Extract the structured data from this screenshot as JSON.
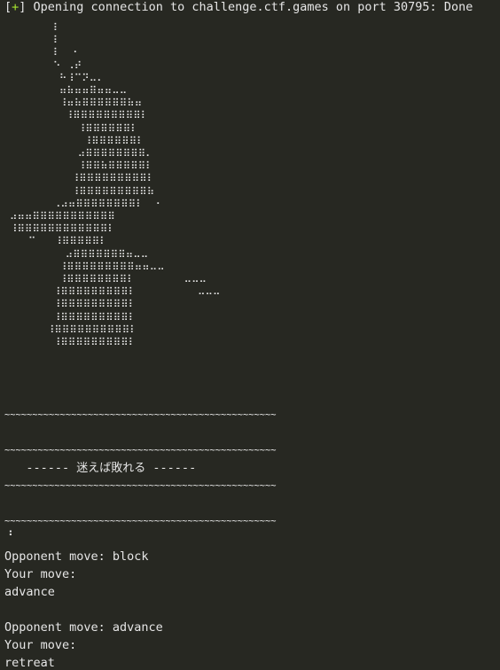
{
  "terminal": {
    "connection_prefix": "[",
    "connection_plus": "+",
    "connection_suffix": "] Opening connection to challenge.ctf.games on port 30795: Done",
    "ascii_art": "        ⠇\n        ⠇\n        ⠇  ⠂\n        ⠑ ⠠⠞\n         ⠓⠸⠉⠝⠤⠄\n         ⠶⠷⠶⠶⠿⠶⠶⠤⠤\n         ⠸⠶⠷⠿⠿⠿⠿⠿⠿⠷⠶\n          ⠸⠿⠿⠿⠿⠿⠿⠿⠿⠿⠇\n            ⠸⠿⠿⠿⠿⠿⠿⠇\n             ⠸⠿⠿⠿⠿⠿⠿⠇\n            ⠴⠿⠿⠿⠿⠿⠿⠿⠿⠄\n            ⠸⠿⠿⠷⠿⠿⠿⠿⠿⠇\n           ⠸⠿⠿⠿⠿⠿⠿⠿⠿⠿⠇\n           ⠸⠿⠿⠿⠿⠿⠿⠿⠿⠿⠷\n        ⠠⠴⠶⠿⠿⠿⠿⠿⠿⠿⠿⠇  ⠂\n ⠴⠶⠶⠿⠿⠿⠿⠿⠿⠿⠿⠿⠿⠿\n ⠸⠿⠿⠿⠿⠿⠿⠿⠿⠿⠿⠿⠿⠇\n    ⠉   ⠸⠿⠿⠿⠿⠿⠇\n          ⠴⠿⠿⠿⠿⠿⠿⠿⠶⠤⠤\n         ⠸⠿⠿⠿⠿⠿⠿⠿⠿⠿⠶⠶⠤⠤\n         ⠸⠿⠿⠿⠿⠿⠿⠿⠿⠇        ⠤⠤⠤\n        ⠸⠿⠿⠿⠿⠿⠿⠿⠿⠿⠇          ⠤⠤⠤\n        ⠸⠿⠿⠿⠿⠿⠿⠿⠿⠿⠇\n        ⠸⠿⠿⠿⠿⠿⠿⠿⠿⠿⠇\n       ⠸⠿⠿⠿⠿⠿⠿⠿⠿⠿⠿⠇\n        ⠸⠿⠿⠿⠿⠿⠿⠿⠿⠿⠇",
    "tilde_rule": "~~~~~~~~~~~~~~~~~~~~~~~~~~~~~~~~~~~~~~~~~~~~~~~~~",
    "banner_dashes_left": "   ------ ",
    "banner_japanese": "迷えば敗れる",
    "banner_dashes_right": " ------",
    "prompt_glyph": "⠘",
    "rounds": [
      {
        "opponent": "Opponent move: block",
        "your_move_label": "Your move:",
        "your_move": "advance"
      },
      {
        "opponent": "Opponent move: advance",
        "your_move_label": "Your move:",
        "your_move": "retreat"
      }
    ]
  },
  "colors": {
    "background": "#272822",
    "text": "#e6e6e6",
    "accent_plus": "#a6e22e"
  }
}
